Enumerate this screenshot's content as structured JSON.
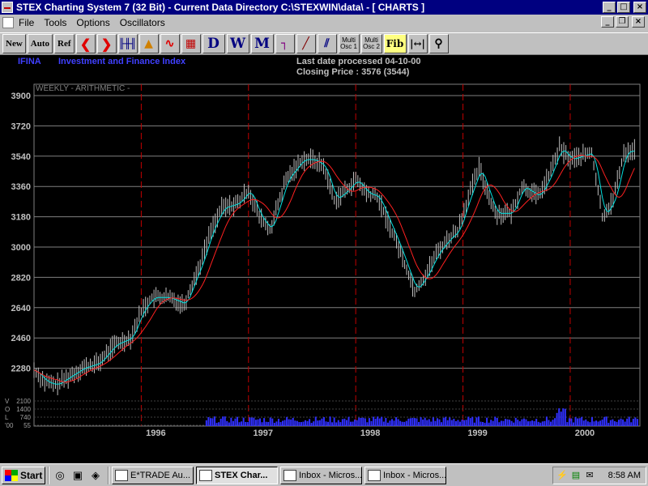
{
  "window": {
    "title": "STEX Charting System 7 (32 Bit)  -  Current Data Directory C:\\STEXWIN\\data\\ - [  CHARTS    ]"
  },
  "menu": {
    "items": [
      {
        "label": "File"
      },
      {
        "label": "Tools"
      },
      {
        "label": "Options"
      },
      {
        "label": "Oscillators"
      }
    ]
  },
  "toolbar": {
    "new_label": "New",
    "auto_label": "Auto",
    "ref_label": "Ref",
    "d_label": "D",
    "w_label": "W",
    "m_label": "M",
    "multi_osc1": [
      "Multi",
      "Osc 1"
    ],
    "multi_osc2": [
      "Multi",
      "Osc 2"
    ],
    "fib_label": "Fib"
  },
  "chart_header": {
    "symbol": "IFINA",
    "name": "Investment and Finance Index",
    "last_date": "Last date processed 04-10-00",
    "closing": "Closing Price : 3576  (3544)",
    "scale_mode": "WEEKLY - ARITHMETIC -"
  },
  "chart_data": {
    "type": "line",
    "title": "Investment and Finance Index",
    "subtitle": "WEEKLY - ARITHMETIC -",
    "xlabel": "",
    "ylabel": "",
    "ylim": [
      2100,
      3900
    ],
    "xlim": [
      1995.0,
      2000.65
    ],
    "y_ticks": [
      3900,
      3720,
      3540,
      3360,
      3180,
      3000,
      2820,
      2640,
      2460,
      2280
    ],
    "x_ticks": [
      "1996",
      "1997",
      "1998",
      "1999",
      "2000"
    ],
    "year_markers": [
      1996.0,
      1997.0,
      1998.0,
      1999.0,
      2000.0
    ],
    "grid": true,
    "colors": {
      "price": "#c0c0c0",
      "ma_short": "#00e0e0",
      "ma_long": "#ff2020",
      "volume": "#3030ff",
      "year_line": "#c00000"
    },
    "series": [
      {
        "name": "",
        "x": [
          1995.0,
          1995.1,
          1995.2,
          1995.3,
          1995.45,
          1995.6,
          1995.75,
          1995.9,
          1996.0,
          1996.1,
          1996.25,
          1996.4,
          1996.55,
          1996.65,
          1996.75,
          1996.9,
          1997.0,
          1997.1,
          1997.2,
          1997.35,
          1997.5,
          1997.6,
          1997.7,
          1997.8,
          1997.9,
          1998.0,
          1998.1,
          1998.2,
          1998.3,
          1998.4,
          1998.55,
          1998.65,
          1998.75,
          1998.85,
          1998.95,
          1999.05,
          1999.15,
          1999.3,
          1999.45,
          1999.55,
          1999.7,
          1999.8,
          1999.9,
          2000.0,
          2000.1,
          2000.2,
          2000.3,
          2000.4,
          2000.5,
          2000.6
        ],
        "values": [
          2270,
          2200,
          2180,
          2220,
          2280,
          2310,
          2420,
          2460,
          2620,
          2700,
          2700,
          2660,
          2900,
          3100,
          3230,
          3260,
          3340,
          3180,
          3100,
          3400,
          3520,
          3520,
          3480,
          3280,
          3330,
          3400,
          3320,
          3300,
          3150,
          3000,
          2740,
          2830,
          2960,
          3040,
          3100,
          3300,
          3470,
          3200,
          3200,
          3360,
          3300,
          3420,
          3590,
          3520,
          3540,
          3560,
          3180,
          3280,
          3560,
          3576
        ]
      }
    ],
    "volume_axis_labels": [
      "2100",
      "1400",
      "740",
      "55"
    ],
    "volume_axis_prefix": [
      "V",
      "O",
      "L",
      "'00"
    ],
    "volume_start": 1996.6
  },
  "taskbar": {
    "start_label": "Start",
    "tasks": [
      {
        "label": "E*TRADE Au..."
      },
      {
        "label": "STEX Char..."
      },
      {
        "label": "Inbox - Micros..."
      },
      {
        "label": "Inbox - Micros..."
      }
    ],
    "clock": "8:58 AM"
  }
}
